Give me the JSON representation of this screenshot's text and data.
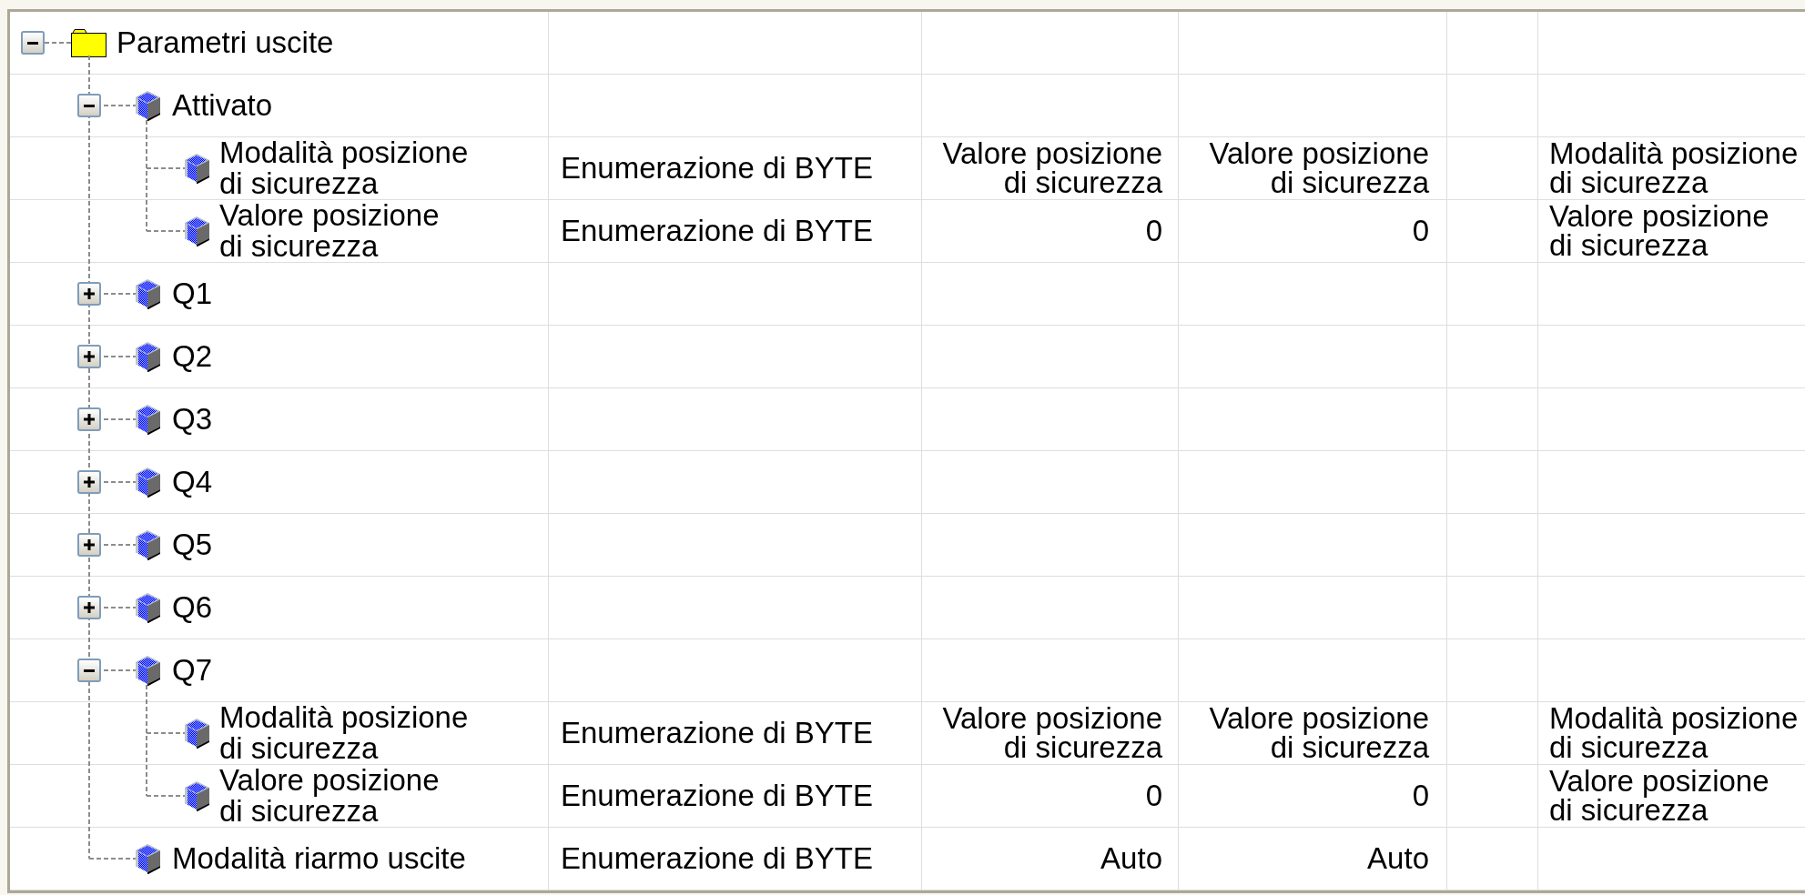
{
  "tree_table": {
    "rows": [
      {
        "kind": "folder",
        "label": "Parametri uscite",
        "expanded": true,
        "children": [
          {
            "kind": "item",
            "label": "Attivato",
            "expanded": true,
            "children": [
              {
                "kind": "item",
                "label": "Modalità posizione di sicurezza",
                "column_2": "Enumerazione di BYTE",
                "column_3": "Valore posizione di sicurezza",
                "column_4": "Valore posizione di sicurezza",
                "column_6": "Modalità posizione di sicurezza"
              },
              {
                "kind": "item",
                "label": "Valore posizione di sicurezza",
                "column_2": "Enumerazione di BYTE",
                "column_3": "0",
                "column_4": "0",
                "column_6": "Valore posizione di sicurezza"
              }
            ]
          },
          {
            "kind": "item",
            "label": "Q1",
            "expanded": false
          },
          {
            "kind": "item",
            "label": "Q2",
            "expanded": false
          },
          {
            "kind": "item",
            "label": "Q3",
            "expanded": false
          },
          {
            "kind": "item",
            "label": "Q4",
            "expanded": false
          },
          {
            "kind": "item",
            "label": "Q5",
            "expanded": false
          },
          {
            "kind": "item",
            "label": "Q6",
            "expanded": false
          },
          {
            "kind": "item",
            "label": "Q7",
            "expanded": true,
            "children": [
              {
                "kind": "item",
                "label": "Modalità posizione di sicurezza",
                "column_2": "Enumerazione di BYTE",
                "column_3": "Valore posizione di sicurezza",
                "column_4": "Valore posizione di sicurezza",
                "column_6": "Modalità posizione di sicurezza"
              },
              {
                "kind": "item",
                "label": "Valore posizione di sicurezza",
                "column_2": "Enumerazione di BYTE",
                "column_3": "0",
                "column_4": "0",
                "column_6": "Valore posizione di sicurezza"
              }
            ]
          },
          {
            "kind": "item",
            "label": "Modalità riarmo uscite",
            "column_2": "Enumerazione di BYTE",
            "column_3": "Auto",
            "column_4": "Auto"
          }
        ]
      }
    ]
  }
}
